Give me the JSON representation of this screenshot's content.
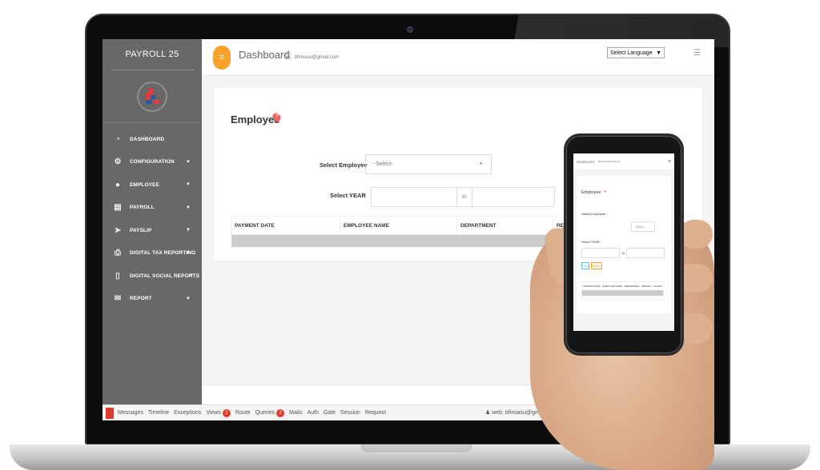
{
  "app": {
    "brand": "PAYROLL 25"
  },
  "header": {
    "page_title": "Dashboard",
    "user_email": "bfinsasu@gmail.com",
    "language_select": "Select Language",
    "menu_icon": "hamburger-icon",
    "toggle_icon": "list-icon"
  },
  "sidebar": {
    "items": [
      {
        "label": "DASHBOARD",
        "icon": "pie-chart-icon",
        "has_caret": false
      },
      {
        "label": "CONFIGURATION",
        "icon": "gear-icon",
        "has_caret": true
      },
      {
        "label": "EMPLOYEE",
        "icon": "user-circle-icon",
        "has_caret": true
      },
      {
        "label": "PAYROLL",
        "icon": "document-icon",
        "has_caret": true
      },
      {
        "label": "PAYSLIP",
        "icon": "send-icon",
        "has_caret": true
      },
      {
        "label": "DIGITAL TAX REPORTING",
        "icon": "printer-icon",
        "has_caret": true
      },
      {
        "label": "DIGITAL SOCIAL REPORTS",
        "icon": "file-icon",
        "has_caret": true
      },
      {
        "label": "REPORT",
        "icon": "envelope-icon",
        "has_caret": true
      }
    ]
  },
  "main": {
    "card_title": "Employee",
    "select_employee_label": "Select Employee",
    "select_employee_value": "-Select-",
    "select_year_label": "Select YEAR",
    "year_from": "",
    "year_to_label": "to",
    "year_to": "",
    "table": {
      "columns": [
        "PAYMENT DATE",
        "EMPLOYEE NAME",
        "DEPARTMENT",
        "REPORT"
      ],
      "rows": []
    }
  },
  "debugbar": {
    "tabs": [
      {
        "label": "Messages"
      },
      {
        "label": "Timeline"
      },
      {
        "label": "Exceptions"
      },
      {
        "label": "Views",
        "badge": "2"
      },
      {
        "label": "Route"
      },
      {
        "label": "Queries",
        "badge": "2"
      },
      {
        "label": "Mails"
      },
      {
        "label": "Auth"
      },
      {
        "label": "Gate"
      },
      {
        "label": "Session"
      },
      {
        "label": "Request"
      }
    ],
    "user": "web: bfinsasu@gmail.c"
  },
  "phone": {
    "header_title": "Dashboard",
    "user_email": "bfinsasu@gmail.com",
    "card_title": "Employee",
    "select_employee_label": "Select Employee",
    "select_value": "-Select-",
    "select_year_label": "Select YEAR",
    "to_label": "to",
    "filter_button": "Filter",
    "refresh_button": "Refresh",
    "table_columns": [
      "PAYMENT DATE",
      "EMPLOYEE NAME",
      "DEPARTMENT",
      "REPORT",
      "ACTION"
    ]
  }
}
